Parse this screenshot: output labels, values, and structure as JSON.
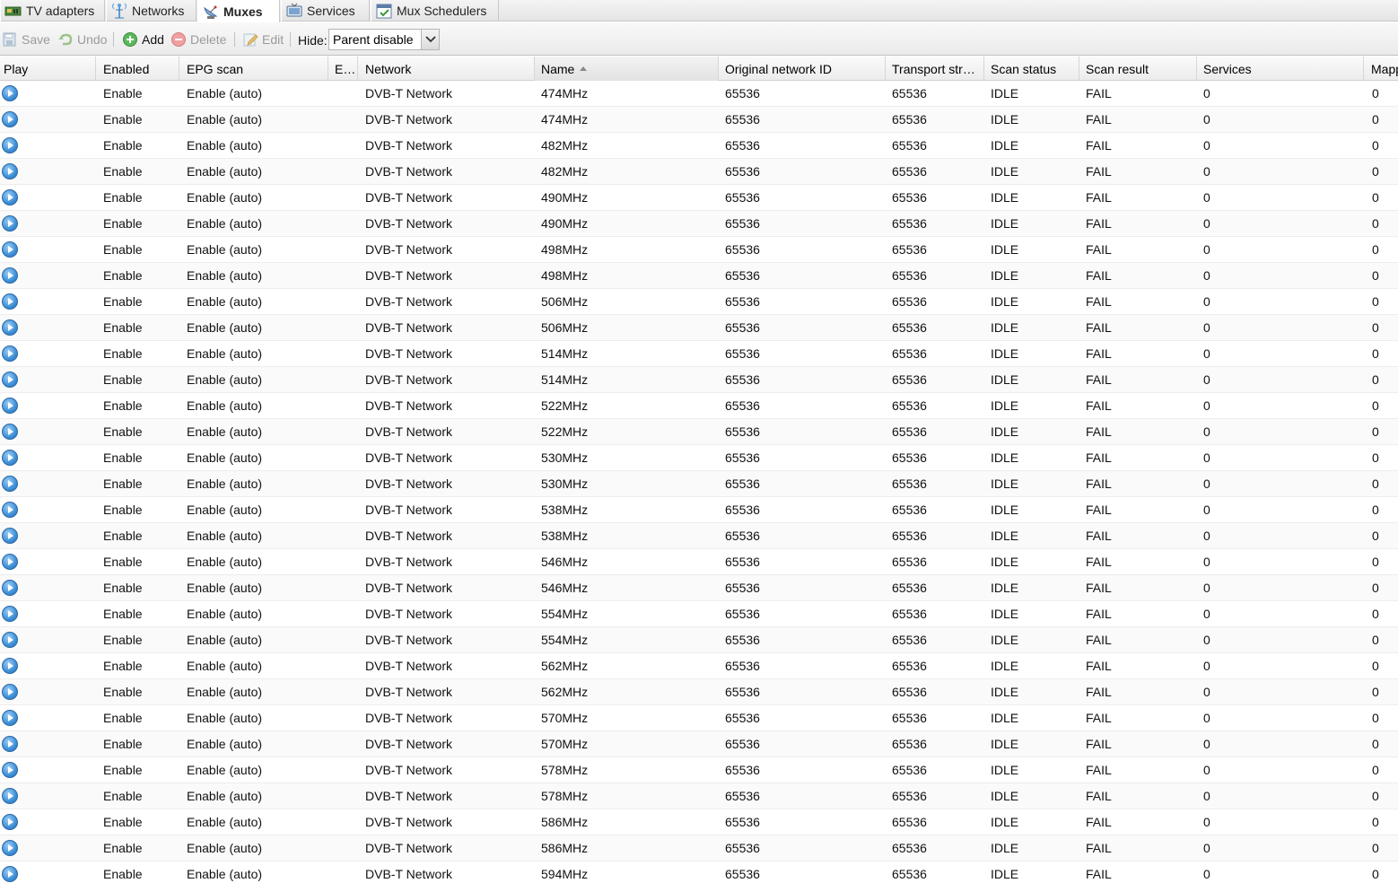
{
  "tabs": [
    {
      "label": "TV adapters",
      "icon": "tv-card-icon",
      "active": false
    },
    {
      "label": "Networks",
      "icon": "antenna-icon",
      "active": false
    },
    {
      "label": "Muxes",
      "icon": "satellite-dish-icon",
      "active": true
    },
    {
      "label": "Services",
      "icon": "tv-service-icon",
      "active": false
    },
    {
      "label": "Mux Schedulers",
      "icon": "calendar-check-icon",
      "active": false
    }
  ],
  "toolbar": {
    "save_label": "Save",
    "undo_label": "Undo",
    "add_label": "Add",
    "delete_label": "Delete",
    "edit_label": "Edit",
    "hide_label": "Hide:",
    "hide_value": "Parent disable"
  },
  "columns": [
    "Play",
    "Enabled",
    "EPG scan",
    "E…",
    "Network",
    "Name",
    "Original network ID",
    "Transport str…",
    "Scan status",
    "Scan result",
    "Services",
    "Mapp"
  ],
  "rows": [
    {
      "enabled": "Enable",
      "epg": "Enable (auto)",
      "e": "",
      "network": "DVB-T Network",
      "name": "474MHz",
      "onid": "65536",
      "tsid": "65536",
      "scan_status": "IDLE",
      "scan_result": "FAIL",
      "services": "0",
      "mapped": "0"
    },
    {
      "enabled": "Enable",
      "epg": "Enable (auto)",
      "e": "",
      "network": "DVB-T Network",
      "name": "474MHz",
      "onid": "65536",
      "tsid": "65536",
      "scan_status": "IDLE",
      "scan_result": "FAIL",
      "services": "0",
      "mapped": "0"
    },
    {
      "enabled": "Enable",
      "epg": "Enable (auto)",
      "e": "",
      "network": "DVB-T Network",
      "name": "482MHz",
      "onid": "65536",
      "tsid": "65536",
      "scan_status": "IDLE",
      "scan_result": "FAIL",
      "services": "0",
      "mapped": "0"
    },
    {
      "enabled": "Enable",
      "epg": "Enable (auto)",
      "e": "",
      "network": "DVB-T Network",
      "name": "482MHz",
      "onid": "65536",
      "tsid": "65536",
      "scan_status": "IDLE",
      "scan_result": "FAIL",
      "services": "0",
      "mapped": "0"
    },
    {
      "enabled": "Enable",
      "epg": "Enable (auto)",
      "e": "",
      "network": "DVB-T Network",
      "name": "490MHz",
      "onid": "65536",
      "tsid": "65536",
      "scan_status": "IDLE",
      "scan_result": "FAIL",
      "services": "0",
      "mapped": "0"
    },
    {
      "enabled": "Enable",
      "epg": "Enable (auto)",
      "e": "",
      "network": "DVB-T Network",
      "name": "490MHz",
      "onid": "65536",
      "tsid": "65536",
      "scan_status": "IDLE",
      "scan_result": "FAIL",
      "services": "0",
      "mapped": "0"
    },
    {
      "enabled": "Enable",
      "epg": "Enable (auto)",
      "e": "",
      "network": "DVB-T Network",
      "name": "498MHz",
      "onid": "65536",
      "tsid": "65536",
      "scan_status": "IDLE",
      "scan_result": "FAIL",
      "services": "0",
      "mapped": "0"
    },
    {
      "enabled": "Enable",
      "epg": "Enable (auto)",
      "e": "",
      "network": "DVB-T Network",
      "name": "498MHz",
      "onid": "65536",
      "tsid": "65536",
      "scan_status": "IDLE",
      "scan_result": "FAIL",
      "services": "0",
      "mapped": "0"
    },
    {
      "enabled": "Enable",
      "epg": "Enable (auto)",
      "e": "",
      "network": "DVB-T Network",
      "name": "506MHz",
      "onid": "65536",
      "tsid": "65536",
      "scan_status": "IDLE",
      "scan_result": "FAIL",
      "services": "0",
      "mapped": "0"
    },
    {
      "enabled": "Enable",
      "epg": "Enable (auto)",
      "e": "",
      "network": "DVB-T Network",
      "name": "506MHz",
      "onid": "65536",
      "tsid": "65536",
      "scan_status": "IDLE",
      "scan_result": "FAIL",
      "services": "0",
      "mapped": "0"
    },
    {
      "enabled": "Enable",
      "epg": "Enable (auto)",
      "e": "",
      "network": "DVB-T Network",
      "name": "514MHz",
      "onid": "65536",
      "tsid": "65536",
      "scan_status": "IDLE",
      "scan_result": "FAIL",
      "services": "0",
      "mapped": "0"
    },
    {
      "enabled": "Enable",
      "epg": "Enable (auto)",
      "e": "",
      "network": "DVB-T Network",
      "name": "514MHz",
      "onid": "65536",
      "tsid": "65536",
      "scan_status": "IDLE",
      "scan_result": "FAIL",
      "services": "0",
      "mapped": "0"
    },
    {
      "enabled": "Enable",
      "epg": "Enable (auto)",
      "e": "",
      "network": "DVB-T Network",
      "name": "522MHz",
      "onid": "65536",
      "tsid": "65536",
      "scan_status": "IDLE",
      "scan_result": "FAIL",
      "services": "0",
      "mapped": "0"
    },
    {
      "enabled": "Enable",
      "epg": "Enable (auto)",
      "e": "",
      "network": "DVB-T Network",
      "name": "522MHz",
      "onid": "65536",
      "tsid": "65536",
      "scan_status": "IDLE",
      "scan_result": "FAIL",
      "services": "0",
      "mapped": "0"
    },
    {
      "enabled": "Enable",
      "epg": "Enable (auto)",
      "e": "",
      "network": "DVB-T Network",
      "name": "530MHz",
      "onid": "65536",
      "tsid": "65536",
      "scan_status": "IDLE",
      "scan_result": "FAIL",
      "services": "0",
      "mapped": "0"
    },
    {
      "enabled": "Enable",
      "epg": "Enable (auto)",
      "e": "",
      "network": "DVB-T Network",
      "name": "530MHz",
      "onid": "65536",
      "tsid": "65536",
      "scan_status": "IDLE",
      "scan_result": "FAIL",
      "services": "0",
      "mapped": "0"
    },
    {
      "enabled": "Enable",
      "epg": "Enable (auto)",
      "e": "",
      "network": "DVB-T Network",
      "name": "538MHz",
      "onid": "65536",
      "tsid": "65536",
      "scan_status": "IDLE",
      "scan_result": "FAIL",
      "services": "0",
      "mapped": "0"
    },
    {
      "enabled": "Enable",
      "epg": "Enable (auto)",
      "e": "",
      "network": "DVB-T Network",
      "name": "538MHz",
      "onid": "65536",
      "tsid": "65536",
      "scan_status": "IDLE",
      "scan_result": "FAIL",
      "services": "0",
      "mapped": "0"
    },
    {
      "enabled": "Enable",
      "epg": "Enable (auto)",
      "e": "",
      "network": "DVB-T Network",
      "name": "546MHz",
      "onid": "65536",
      "tsid": "65536",
      "scan_status": "IDLE",
      "scan_result": "FAIL",
      "services": "0",
      "mapped": "0"
    },
    {
      "enabled": "Enable",
      "epg": "Enable (auto)",
      "e": "",
      "network": "DVB-T Network",
      "name": "546MHz",
      "onid": "65536",
      "tsid": "65536",
      "scan_status": "IDLE",
      "scan_result": "FAIL",
      "services": "0",
      "mapped": "0"
    },
    {
      "enabled": "Enable",
      "epg": "Enable (auto)",
      "e": "",
      "network": "DVB-T Network",
      "name": "554MHz",
      "onid": "65536",
      "tsid": "65536",
      "scan_status": "IDLE",
      "scan_result": "FAIL",
      "services": "0",
      "mapped": "0"
    },
    {
      "enabled": "Enable",
      "epg": "Enable (auto)",
      "e": "",
      "network": "DVB-T Network",
      "name": "554MHz",
      "onid": "65536",
      "tsid": "65536",
      "scan_status": "IDLE",
      "scan_result": "FAIL",
      "services": "0",
      "mapped": "0"
    },
    {
      "enabled": "Enable",
      "epg": "Enable (auto)",
      "e": "",
      "network": "DVB-T Network",
      "name": "562MHz",
      "onid": "65536",
      "tsid": "65536",
      "scan_status": "IDLE",
      "scan_result": "FAIL",
      "services": "0",
      "mapped": "0"
    },
    {
      "enabled": "Enable",
      "epg": "Enable (auto)",
      "e": "",
      "network": "DVB-T Network",
      "name": "562MHz",
      "onid": "65536",
      "tsid": "65536",
      "scan_status": "IDLE",
      "scan_result": "FAIL",
      "services": "0",
      "mapped": "0"
    },
    {
      "enabled": "Enable",
      "epg": "Enable (auto)",
      "e": "",
      "network": "DVB-T Network",
      "name": "570MHz",
      "onid": "65536",
      "tsid": "65536",
      "scan_status": "IDLE",
      "scan_result": "FAIL",
      "services": "0",
      "mapped": "0"
    },
    {
      "enabled": "Enable",
      "epg": "Enable (auto)",
      "e": "",
      "network": "DVB-T Network",
      "name": "570MHz",
      "onid": "65536",
      "tsid": "65536",
      "scan_status": "IDLE",
      "scan_result": "FAIL",
      "services": "0",
      "mapped": "0"
    },
    {
      "enabled": "Enable",
      "epg": "Enable (auto)",
      "e": "",
      "network": "DVB-T Network",
      "name": "578MHz",
      "onid": "65536",
      "tsid": "65536",
      "scan_status": "IDLE",
      "scan_result": "FAIL",
      "services": "0",
      "mapped": "0"
    },
    {
      "enabled": "Enable",
      "epg": "Enable (auto)",
      "e": "",
      "network": "DVB-T Network",
      "name": "578MHz",
      "onid": "65536",
      "tsid": "65536",
      "scan_status": "IDLE",
      "scan_result": "FAIL",
      "services": "0",
      "mapped": "0"
    },
    {
      "enabled": "Enable",
      "epg": "Enable (auto)",
      "e": "",
      "network": "DVB-T Network",
      "name": "586MHz",
      "onid": "65536",
      "tsid": "65536",
      "scan_status": "IDLE",
      "scan_result": "FAIL",
      "services": "0",
      "mapped": "0"
    },
    {
      "enabled": "Enable",
      "epg": "Enable (auto)",
      "e": "",
      "network": "DVB-T Network",
      "name": "586MHz",
      "onid": "65536",
      "tsid": "65536",
      "scan_status": "IDLE",
      "scan_result": "FAIL",
      "services": "0",
      "mapped": "0"
    },
    {
      "enabled": "Enable",
      "epg": "Enable (auto)",
      "e": "",
      "network": "DVB-T Network",
      "name": "594MHz",
      "onid": "65536",
      "tsid": "65536",
      "scan_status": "IDLE",
      "scan_result": "FAIL",
      "services": "0",
      "mapped": "0"
    }
  ]
}
